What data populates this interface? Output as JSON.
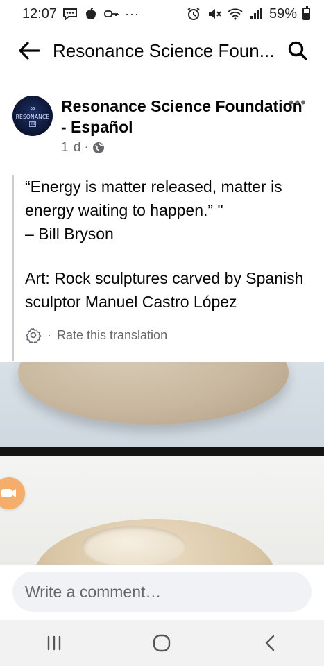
{
  "status_bar": {
    "time": "12:07",
    "dots": "···",
    "battery": "59%",
    "battery_level": 0.59,
    "left_icons": [
      "chat-icon",
      "apple-icon",
      "key-icon"
    ],
    "right_icons": [
      "alarm-icon",
      "mute-icon",
      "wifi-icon",
      "signal-icon",
      "battery-icon"
    ]
  },
  "header": {
    "title": "Resonance Science Foun...",
    "back_icon": "arrow-left-icon",
    "search_icon": "search-icon"
  },
  "post": {
    "page_name": "Resonance Science Foundation - Español",
    "time": "1 d",
    "separator": "·",
    "privacy_icon": "globe-icon",
    "more_label": "•••",
    "avatar": {
      "logo": "∞",
      "brand": "RESONANCE",
      "badge": "ES"
    },
    "quote_line1": "“Energy is matter released, matter is energy waiting to happen.” \"",
    "quote_line2": "– Bill Bryson",
    "art_text": "Art: Rock sculptures carved by Spanish sculptor Manuel Castro López",
    "rate_separator": "·",
    "rate_label": "Rate this translation"
  },
  "comment": {
    "placeholder": "Write a comment…"
  },
  "navigation": {
    "items": [
      "recent-apps-icon",
      "home-icon",
      "back-icon"
    ]
  },
  "colors": {
    "secondary_text": "#65676b",
    "input_bg": "#f0f2f5",
    "fab": "#f4ad6a"
  }
}
